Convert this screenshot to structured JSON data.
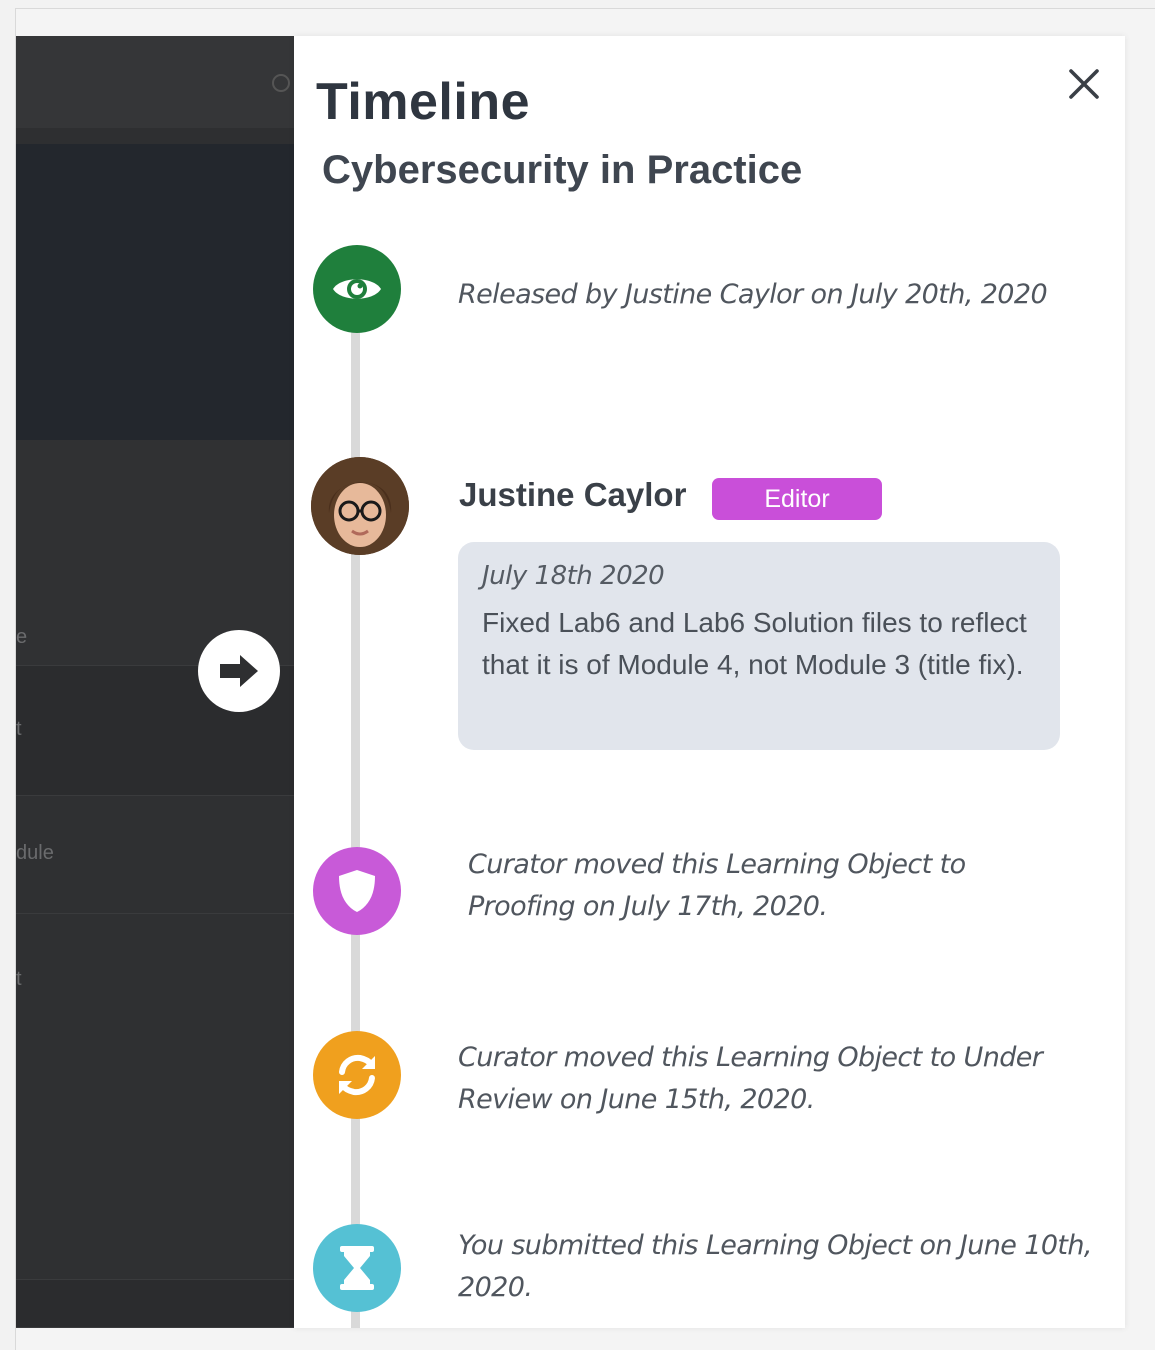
{
  "backdrop": {
    "fragments": [
      "e",
      "t",
      "dule",
      "t"
    ]
  },
  "timeline": {
    "title": "Timeline",
    "subtitle": "Cybersecurity in Practice",
    "events": {
      "release": {
        "text": "Released by Justine Caylor on July 20th, 2020",
        "icon": "eye-icon",
        "color": "#1f7f3c"
      },
      "comment": {
        "author": "Justine Caylor",
        "role": "Editor",
        "date": "July 18th 2020",
        "body": "Fixed Lab6 and Lab6 Solution files to reflect that it is of Module 4, not Module 3 (title fix).",
        "role_color": "#c94fd9"
      },
      "proofing": {
        "text": "Curator moved this Learning Object to Proofing on July 17th, 2020.",
        "icon": "shield-icon",
        "color": "#c85ad8"
      },
      "review": {
        "text": "Curator moved this Learning Object to Under Review on June 15th, 2020.",
        "icon": "refresh-icon",
        "color": "#f0a01e"
      },
      "submitted": {
        "text": "You submitted this Learning Object on June 10th, 2020.",
        "icon": "hourglass-icon",
        "color": "#55c1d4"
      }
    }
  }
}
